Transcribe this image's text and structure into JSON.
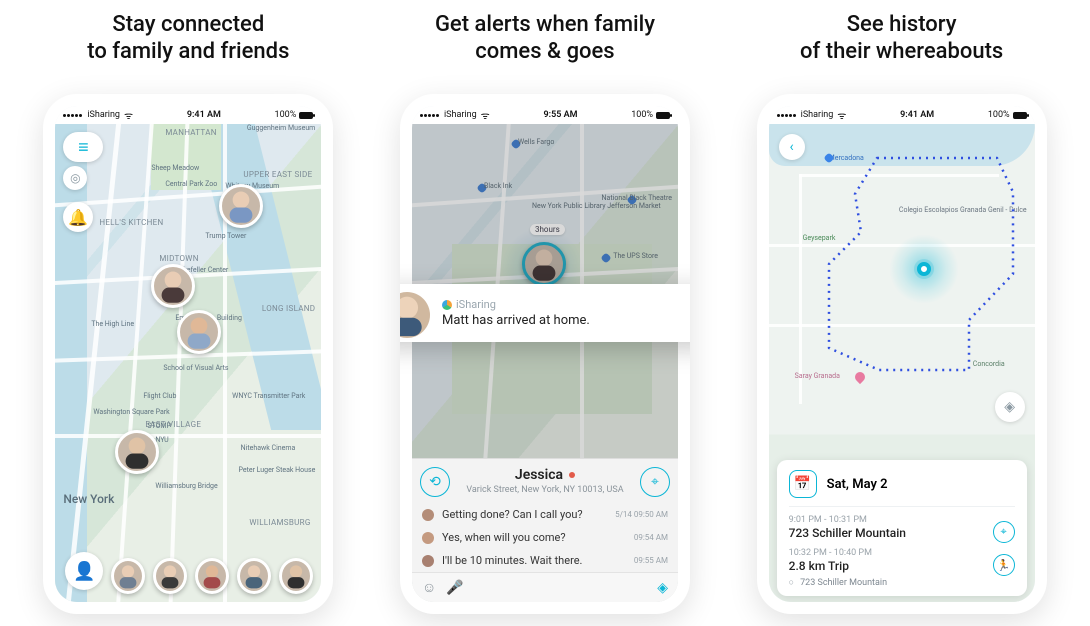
{
  "status": {
    "carrier": "iSharing",
    "time1": "9:41 AM",
    "time2": "9:55 AM",
    "time3": "9:41 AM",
    "battery": "100%"
  },
  "headlines": {
    "h1a": "Stay connected",
    "h1b": "to family and friends",
    "h2a": "Get alerts when family",
    "h2b": "comes & goes",
    "h3a": "See history",
    "h3b": "of their whereabouts"
  },
  "phone1": {
    "map_labels": {
      "manhattan": "MANHATTAN",
      "midtown": "MIDTOWN",
      "hells_kitchen": "HELL'S KITCHEN",
      "upper_east": "UPPER EAST SIDE",
      "east_village": "EAST VILLAGE",
      "williamsburg": "WILLIAMSBURG",
      "long_island": "LONG ISLAND",
      "ny": "New York"
    },
    "pois": {
      "guggenheim": "Guggenheim Museum",
      "sheep": "Sheep Meadow",
      "centralpark": "Central Park Zoo",
      "trump": "Trump Tower",
      "nyu": "NYU",
      "rockefeller": "Rockefeller Center",
      "esb": "Empire State Building",
      "highline": "The High Line",
      "flight": "Flight Club",
      "washington": "Washington Square Park",
      "stomp": "STOMP",
      "wnyc": "WNYC Transmitter Park",
      "nitehawk": "Nitehawk Cinema",
      "luger": "Peter Luger Steak House",
      "williamsburg_br": "Williamsburg Bridge",
      "sva": "School of Visual Arts",
      "whitney": "Whitney Museum"
    }
  },
  "phone2": {
    "pois": {
      "wellsfargo": "Wells Fargo",
      "blackink": "Black Ink",
      "nypl": "New York Public Library Jefferson Market",
      "natblack": "National Black Theatre",
      "ups": "The UPS Store"
    },
    "tag": "3hours",
    "notification": {
      "app": "iSharing",
      "message": "Matt has arrived at home."
    },
    "person": {
      "name": "Jessica",
      "address": "Varick Street, New York, NY 10013, USA"
    },
    "chat": [
      {
        "text": "Getting done? Can I call you?",
        "time": "5/14 09:50 AM"
      },
      {
        "text": "Yes, when will you come?",
        "time": "09:54 AM"
      },
      {
        "text": "I'll be 10 minutes. Wait there.",
        "time": "09:55 AM"
      }
    ]
  },
  "phone3": {
    "pois": {
      "mercadona": "Mercadona",
      "geysepark": "Geysepark",
      "escolapios": "Colegio Escolapios Granada Genil - Dulce",
      "saray": "Saray Granada",
      "concordia": "Concordia"
    },
    "history": {
      "date": "Sat, May  2",
      "rows": [
        {
          "time": "9:01 PM - 10:31 PM",
          "title": "723 Schiller Mountain",
          "icon": "pin"
        },
        {
          "time": "10:32 PM - 10:40 PM",
          "title": "2.8 km Trip",
          "sub": "723 Schiller Mountain",
          "icon": "run"
        }
      ]
    }
  }
}
